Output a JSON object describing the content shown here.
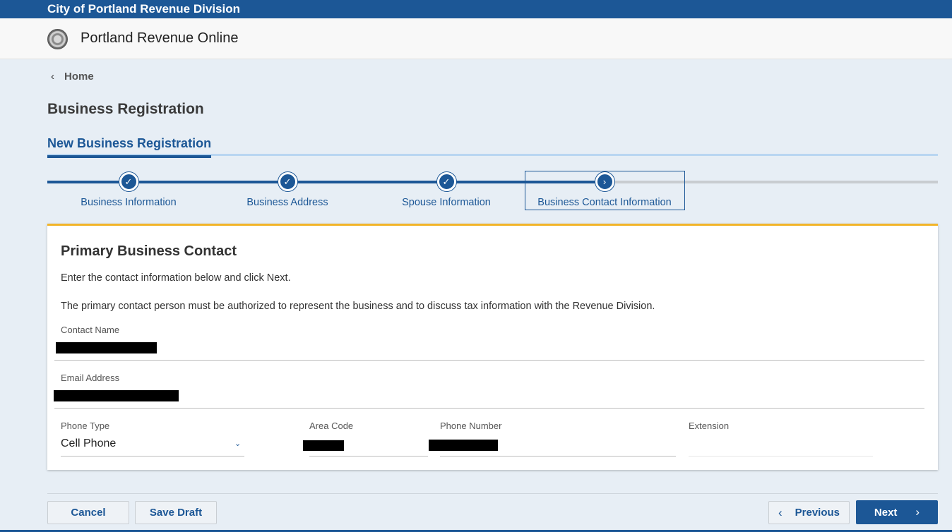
{
  "header": {
    "org_name": "City of Portland Revenue Division",
    "app_title": "Portland Revenue Online",
    "seal_icon": "city-seal-icon"
  },
  "breadcrumb": {
    "label": "Home"
  },
  "page": {
    "title": "Business Registration"
  },
  "subtabs": [
    {
      "label": "New Business Registration",
      "active": true
    }
  ],
  "stepper": {
    "steps": [
      {
        "label": "Business Information",
        "status": "complete"
      },
      {
        "label": "Business Address",
        "status": "complete"
      },
      {
        "label": "Spouse Information",
        "status": "complete"
      },
      {
        "label": "Business Contact Information",
        "status": "current"
      }
    ]
  },
  "card": {
    "title": "Primary Business Contact",
    "instruction": "Enter the contact information below and click Next.",
    "note": "The primary contact person must be authorized to represent the business and to discuss tax information with the Revenue Division.",
    "fields": {
      "contact_name": {
        "label": "Contact Name",
        "value": ""
      },
      "email": {
        "label": "Email Address",
        "value": ""
      },
      "phone_type": {
        "label": "Phone Type",
        "value": "Cell Phone"
      },
      "area_code": {
        "label": "Area Code",
        "value": ""
      },
      "phone_number": {
        "label": "Phone Number",
        "value": ""
      },
      "extension": {
        "label": "Extension",
        "value": ""
      }
    }
  },
  "footer": {
    "cancel_label": "Cancel",
    "save_draft_label": "Save Draft",
    "previous_label": "Previous",
    "next_label": "Next"
  },
  "colors": {
    "brand_blue": "#1c5796",
    "accent_yellow": "#f2b52a",
    "page_bg": "#e7eef5"
  }
}
